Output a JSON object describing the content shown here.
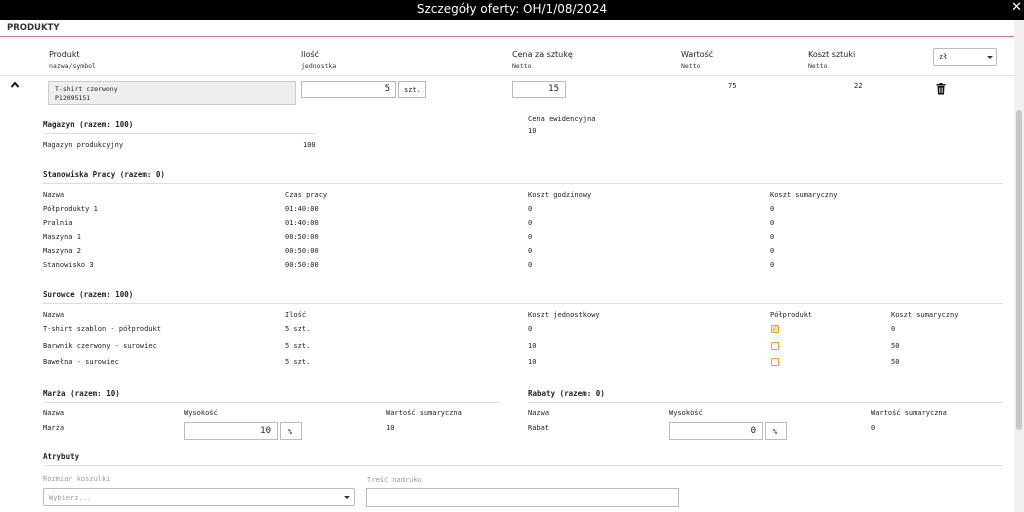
{
  "window": {
    "title": "Szczegóły oferty: OH/1/08/2024",
    "close": "✕"
  },
  "section": "PRODUKTY",
  "columns": {
    "product": {
      "label": "Produkt",
      "sub": "nazwa/symbol"
    },
    "qty": {
      "label": "Ilość",
      "sub": "jednostka"
    },
    "unit_price": {
      "label": "Cena za sztukę",
      "sub": "Netto"
    },
    "value": {
      "label": "Wartość",
      "sub": "Netto"
    },
    "unit_cost": {
      "label": "Koszt sztuki",
      "sub": "Netto"
    },
    "currency": "zł"
  },
  "product": {
    "name": "T-shirt czerwony",
    "symbol": "P12095151",
    "qty": "5",
    "unit": "szt.",
    "price": "15",
    "value": "75",
    "cost": "22"
  },
  "warehouse": {
    "title": "Magazyn (razem: 100)",
    "row_name": "Magazyn produkcyjny",
    "row_value": "100",
    "eval_label": "Cena ewidencyjna",
    "eval_value": "10"
  },
  "stations": {
    "title": "Stanowiska Pracy (razem: 0)",
    "headers": [
      "Nazwa",
      "Czas pracy",
      "Koszt godzinowy",
      "Koszt sumaryczny"
    ],
    "rows": [
      [
        "Półprodukty 1",
        "01:40:00",
        "0",
        "0"
      ],
      [
        "Pralnia",
        "01:40:00",
        "0",
        "0"
      ],
      [
        "Maszyna 1",
        "00:50:00",
        "0",
        "0"
      ],
      [
        "Maszyna 2",
        "00:50:00",
        "0",
        "0"
      ],
      [
        "Stanowisko 3",
        "00:50:00",
        "0",
        "0"
      ]
    ]
  },
  "materials": {
    "title": "Surowce (razem: 100)",
    "headers": [
      "Nazwa",
      "Ilość",
      "Koszt jednostkowy",
      "Półprodukt",
      "Koszt sumaryczny"
    ],
    "rows": [
      {
        "name": "T-shirt szablon - półprodukt",
        "qty": "5 szt.",
        "unit_cost": "0",
        "semi": true,
        "total": "0"
      },
      {
        "name": "Barwnik czerwony - surowiec",
        "qty": "5 szt.",
        "unit_cost": "10",
        "semi": false,
        "total": "50"
      },
      {
        "name": "Bawełna - surowiec",
        "qty": "5 szt.",
        "unit_cost": "10",
        "semi": false,
        "total": "50"
      }
    ]
  },
  "margin": {
    "title": "Marża (razem: 10)",
    "headers": [
      "Nazwa",
      "Wysokość",
      "Wartość sumaryczna"
    ],
    "name": "Marża",
    "amount": "10",
    "unit": "%",
    "total": "10"
  },
  "discount": {
    "title": "Rabaty (razem: 0)",
    "headers": [
      "Nazwa",
      "Wysokość",
      "Wartość sumaryczna"
    ],
    "name": "Rabat",
    "amount": "0",
    "unit": "%",
    "total": "0"
  },
  "attributes": {
    "title": "Atrybuty",
    "size_label": "Rozmiar koszulki",
    "size_placeholder": "Wybierz...",
    "print_label": "Treść nadruku",
    "print_value": ""
  }
}
